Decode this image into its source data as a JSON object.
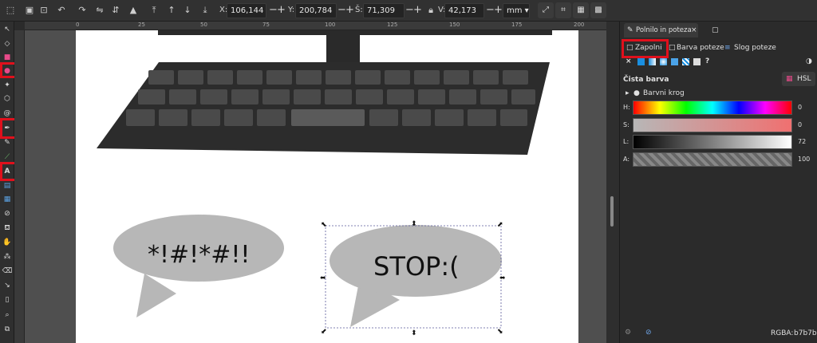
{
  "toolbar": {
    "x_label": "X:",
    "x_value": "106,144",
    "y_label": "Y:",
    "y_value": "200,784",
    "w_label": "Š:",
    "w_value": "71,309",
    "h_label": "V:",
    "h_value": "42,173",
    "unit": "mm",
    "plus": "+",
    "minus": "−"
  },
  "ruler": {
    "marks": [
      "0",
      "25",
      "50",
      "75",
      "100",
      "125",
      "150",
      "175",
      "200"
    ]
  },
  "canvas": {
    "bubble_left_text": "*!#!*#!!",
    "bubble_right_text": "STOP:("
  },
  "panel": {
    "tab_title": "Polnilo in poteza",
    "tab_close": "×",
    "subtab_fill": "Zapolni",
    "subtab_stroke_paint": "Barva poteze",
    "subtab_stroke_style": "Slog poteze",
    "section_flat": "Čista barva",
    "mode_button": "HSL",
    "color_wheel": "Barvni krog",
    "sliders": [
      {
        "label": "H:",
        "value": "0"
      },
      {
        "label": "S:",
        "value": "0"
      },
      {
        "label": "L:",
        "value": "72"
      },
      {
        "label": "A:",
        "value": "100"
      }
    ],
    "rgba_label": "RGBA:",
    "rgba_value": "b7b7b7",
    "unknown_icon": "?",
    "x_icon": "×"
  },
  "colors": {
    "accent_red": "#e0101c",
    "fill_gray": "#b7b7b7",
    "keyboard": "#2c2c2c"
  }
}
